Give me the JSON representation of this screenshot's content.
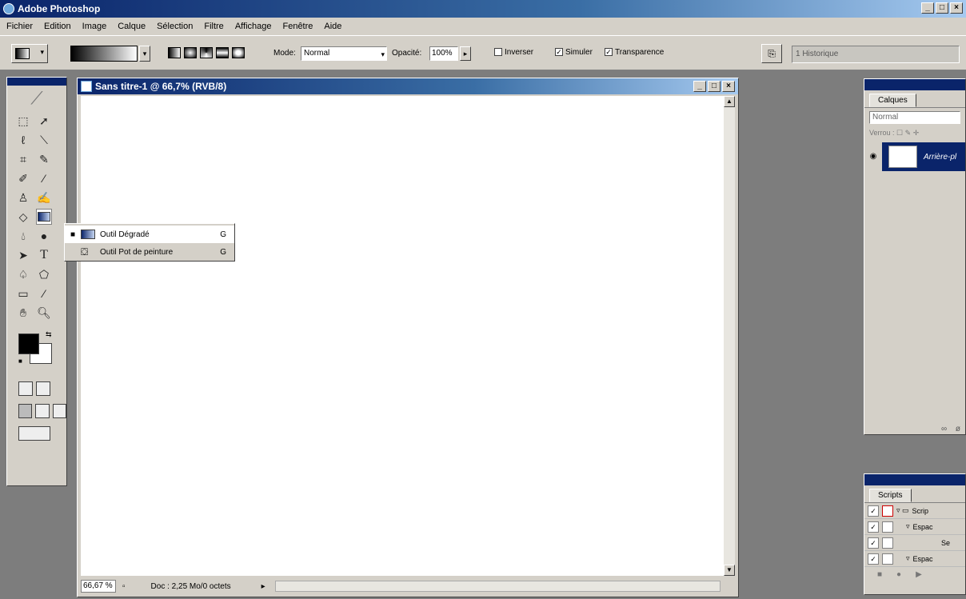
{
  "app": {
    "title": "Adobe Photoshop",
    "win_buttons": [
      "_",
      "□",
      "×"
    ]
  },
  "menu": [
    "Fichier",
    "Edition",
    "Image",
    "Calque",
    "Sélection",
    "Filtre",
    "Affichage",
    "Fenêtre",
    "Aide"
  ],
  "options": {
    "mode_label": "Mode:",
    "mode_value": "Normal",
    "opacity_label": "Opacité:",
    "opacity_value": "100%",
    "inverser": "Inverser",
    "simuler": "Simuler",
    "transparence": "Transparence",
    "historique": "1 Historique"
  },
  "flyout": {
    "items": [
      {
        "label": "Outil Dégradé",
        "key": "G",
        "selected": true
      },
      {
        "label": "Outil Pot de peinture",
        "key": "G",
        "selected": false
      }
    ]
  },
  "document": {
    "title": "Sans titre-1 @ 66,7% (RVB/8)",
    "zoom": "66,67 %",
    "doc_info": "Doc : 2,25 Mo/0 octets"
  },
  "layers_panel": {
    "tab": "Calques",
    "blend": "Normal",
    "lock_label": "Verrou :",
    "layer_name": "Arrière-pl"
  },
  "scripts_panel": {
    "tab": "Scripts",
    "rows": [
      "Scrip",
      "Espac",
      "Se",
      "Espac"
    ]
  },
  "colors": {
    "titlebar": "#0a246a",
    "chrome": "#d4d0c8",
    "workspace": "#7d7d7d"
  }
}
